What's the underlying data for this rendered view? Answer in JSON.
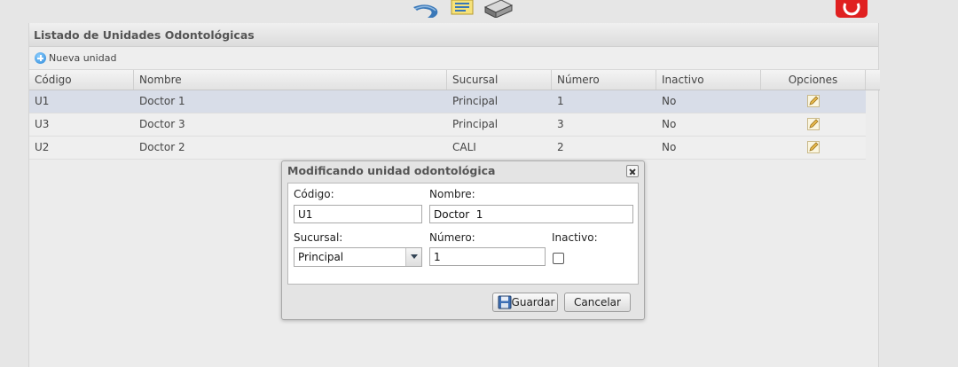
{
  "icons": {
    "back": "back-arrow-icon",
    "note": "note-icon",
    "print": "printer-icon",
    "power": "power-icon",
    "new": "plus-icon",
    "edit": "pencil-icon",
    "close": "close-icon",
    "save": "floppy-disk-icon",
    "dropdown": "chevron-down-icon"
  },
  "colors": {
    "selected_row": "#d8dde8",
    "power_red": "#e02020",
    "plus_blue": "#2b87d8"
  },
  "panel": {
    "title": "Listado de Unidades Odontológicas",
    "new_label": "Nueva unidad"
  },
  "grid": {
    "columns": [
      "Código",
      "Nombre",
      "Sucursal",
      "Número",
      "Inactivo",
      "Opciones"
    ],
    "rows": [
      {
        "codigo": "U1",
        "nombre": "Doctor 1",
        "sucursal": "Principal",
        "numero": "1",
        "inactivo": "No",
        "selected": true
      },
      {
        "codigo": "U3",
        "nombre": "Doctor 3",
        "sucursal": "Principal",
        "numero": "3",
        "inactivo": "No",
        "selected": false
      },
      {
        "codigo": "U2",
        "nombre": "Doctor 2",
        "sucursal": "CALI",
        "numero": "2",
        "inactivo": "No",
        "selected": false
      }
    ]
  },
  "dialog": {
    "title": "Modificando unidad odontológica",
    "codigo_label": "Código:",
    "codigo_value": "U1",
    "nombre_label": "Nombre:",
    "nombre_value": "Doctor  1",
    "sucursal_label": "Sucursal:",
    "sucursal_value": "Principal",
    "numero_label": "Número:",
    "numero_value": "1",
    "inactivo_label": "Inactivo:",
    "inactivo_checked": false,
    "save_label": "Guardar",
    "cancel_label": "Cancelar"
  }
}
